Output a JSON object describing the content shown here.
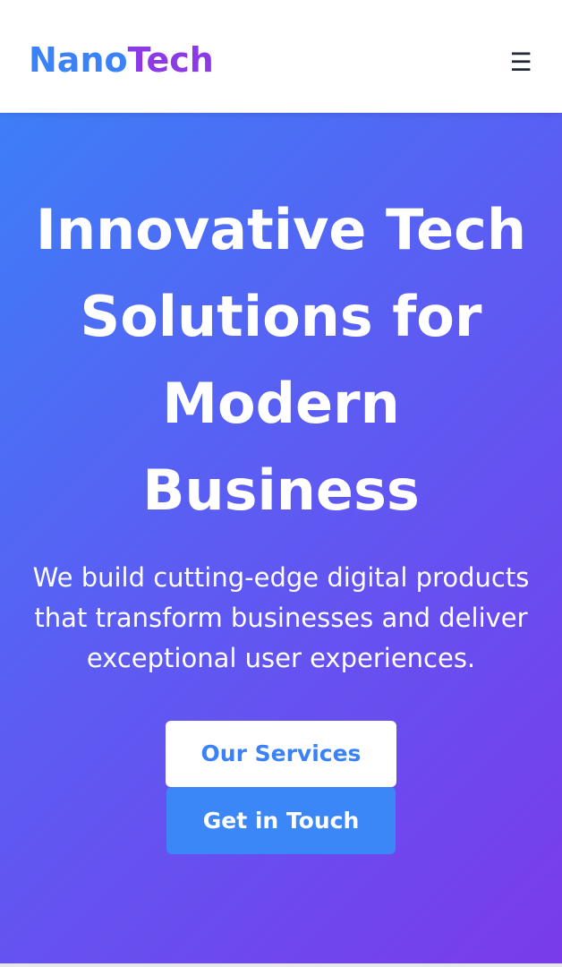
{
  "header": {
    "logo_part1": "Nano",
    "logo_part2": "Tech",
    "menu_icon": "☰",
    "menu_icon_name": "hamburger-menu-icon"
  },
  "hero": {
    "title": "Innovative Tech Solutions for Modern Business",
    "subtitle": "We build cutting-edge digital products that transform businesses and deliver exceptional user experiences.",
    "primary_button": "Our Services",
    "secondary_button": "Get in Touch"
  },
  "colors": {
    "brand_blue": "#3b82f6",
    "brand_purple": "#8b3ae6",
    "gradient_start": "#3d7ef7",
    "gradient_end": "#7a3be9",
    "text_dark": "#1f2937",
    "white": "#ffffff"
  }
}
